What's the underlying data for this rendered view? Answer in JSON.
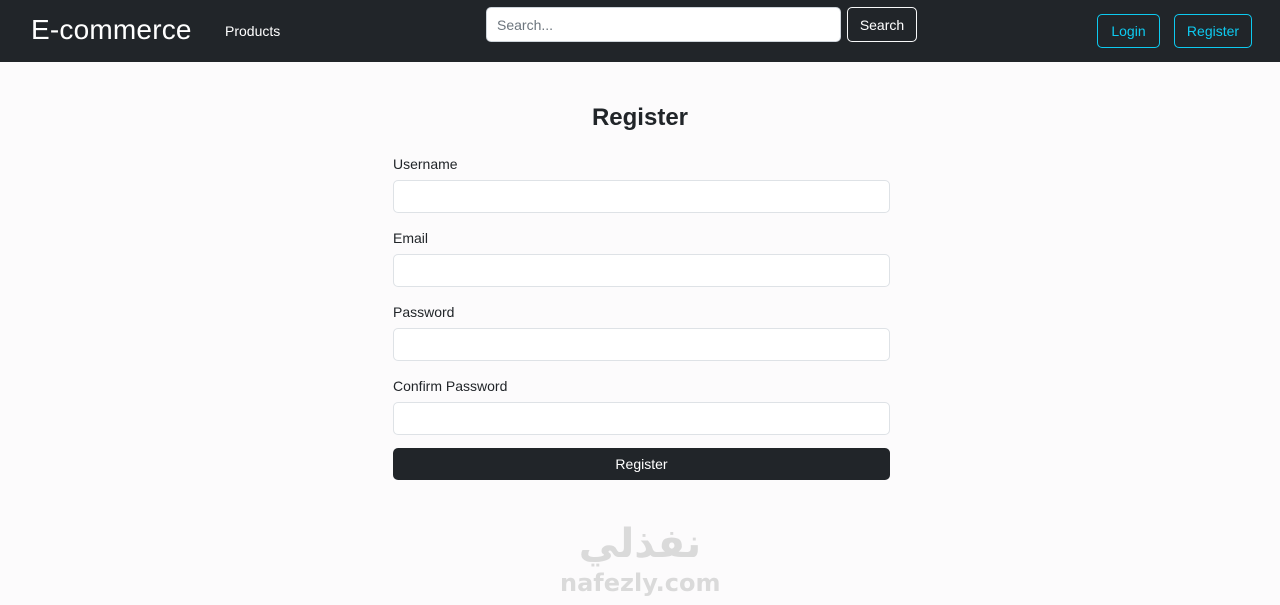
{
  "navbar": {
    "brand": "E-commerce",
    "products_link": "Products",
    "search_placeholder": "Search...",
    "search_button": "Search",
    "login_button": "Login",
    "register_button": "Register",
    "accent_color": "#0dcaf0",
    "background_color": "#212529"
  },
  "form": {
    "title": "Register",
    "fields": [
      {
        "label": "Username",
        "value": ""
      },
      {
        "label": "Email",
        "value": ""
      },
      {
        "label": "Password",
        "value": ""
      },
      {
        "label": "Confirm Password",
        "value": ""
      }
    ],
    "submit_label": "Register"
  },
  "watermark": {
    "arabic": "نفذلي",
    "latin": "nafezly.com"
  }
}
